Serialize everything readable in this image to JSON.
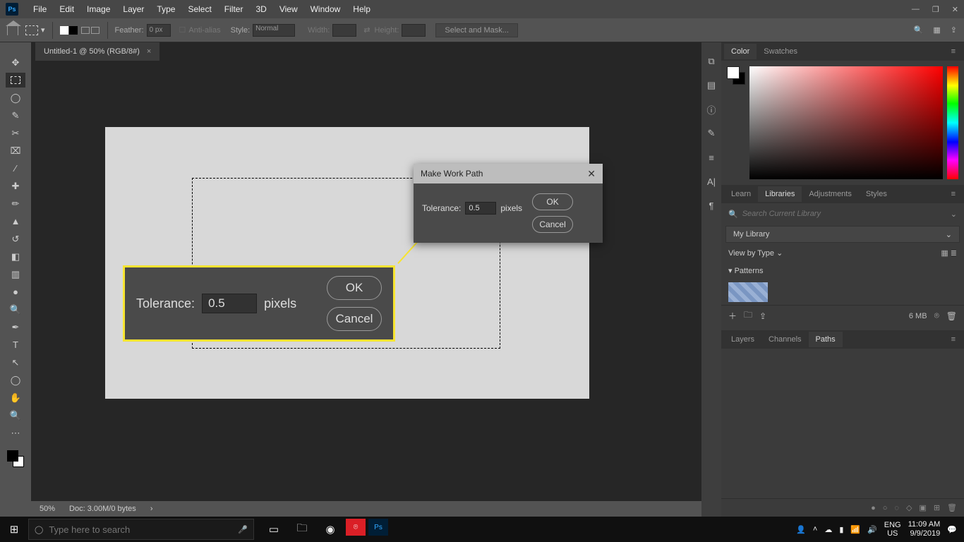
{
  "menubar": {
    "items": [
      "File",
      "Edit",
      "Image",
      "Layer",
      "Type",
      "Select",
      "Filter",
      "3D",
      "View",
      "Window",
      "Help"
    ]
  },
  "optionsBar": {
    "feather_label": "Feather:",
    "feather_value": "0 px",
    "antialias_label": "Anti-alias",
    "style_label": "Style:",
    "style_value": "Normal",
    "width_label": "Width:",
    "height_label": "Height:",
    "mask_btn": "Select and Mask..."
  },
  "document": {
    "tab": "Untitled-1 @ 50% (RGB/8#)",
    "zoom": "50%",
    "info": "Doc: 3.00M/0 bytes"
  },
  "dialog": {
    "title": "Make Work Path",
    "tolerance_label": "Tolerance:",
    "tolerance_value": "0.5",
    "unit": "pixels",
    "ok": "OK",
    "cancel": "Cancel"
  },
  "panels": {
    "color_tabs": [
      "Color",
      "Swatches"
    ],
    "lib_tabs": [
      "Learn",
      "Libraries",
      "Adjustments",
      "Styles"
    ],
    "lib_search_placeholder": "Search Current Library",
    "lib_name": "My Library",
    "view_by": "View by Type",
    "section": "Patterns",
    "storage": "6 MB",
    "lower_tabs": [
      "Layers",
      "Channels",
      "Paths"
    ]
  },
  "taskbar": {
    "search_placeholder": "Type here to search",
    "lang": "ENG",
    "locale": "US",
    "time": "11:09 AM",
    "date": "9/9/2019"
  }
}
